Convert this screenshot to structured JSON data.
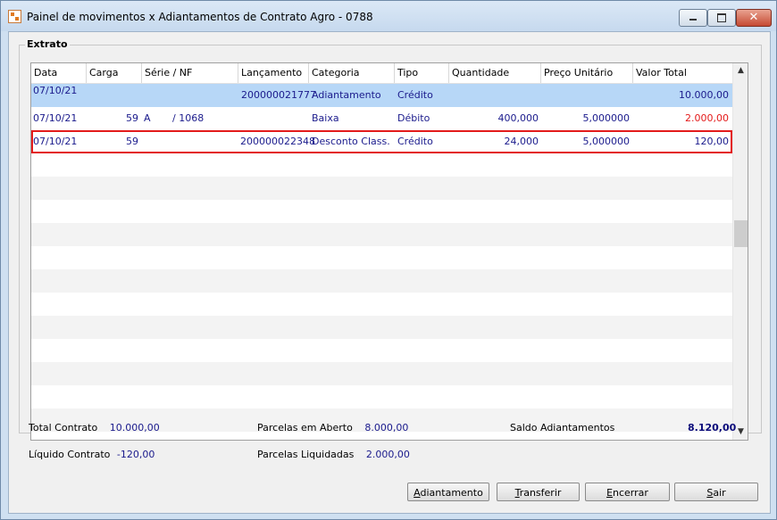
{
  "window": {
    "title": "Painel de movimentos x Adiantamentos de Contrato Agro - 0788",
    "minimize": "minimize",
    "maximize": "maximize",
    "close": "✕"
  },
  "extrato": {
    "title": "Extrato",
    "columns": [
      "Data",
      "Carga",
      "Série / NF",
      "Lançamento",
      "Categoria",
      "Tipo",
      "Quantidade",
      "Preço Unitário",
      "Valor Total"
    ],
    "rows": [
      {
        "data": "07/10/21",
        "carga": "",
        "serie": "",
        "nf": "",
        "lancamento": "200000021777",
        "categoria": "Adiantamento",
        "tipo": "Crédito",
        "quantidade": "",
        "preco": "",
        "valor": "10.000,00"
      },
      {
        "data": "07/10/21",
        "carga": "59",
        "serie": "A",
        "nf": "/ 1068",
        "lancamento": "",
        "categoria": "Baixa",
        "tipo": "Débito",
        "quantidade": "400,000",
        "preco": "5,000000",
        "valor": "2.000,00"
      },
      {
        "data": "07/10/21",
        "carga": "59",
        "serie": "",
        "nf": "",
        "lancamento": "200000022348",
        "categoria": "Desconto Class.",
        "tipo": "Crédito",
        "quantidade": "24,000",
        "preco": "5,000000",
        "valor": "120,00"
      }
    ],
    "colors": {
      "selected_row": "#b7d7f7",
      "highlight_border": "#e31b1b",
      "debit_value": "#e41a1a",
      "text": "#1a1a8c"
    }
  },
  "summary": {
    "total_contrato_label": "Total Contrato",
    "total_contrato_value": "10.000,00",
    "liquido_contrato_label": "Líquido Contrato",
    "liquido_contrato_value": "-120,00",
    "parcelas_aberto_label": "Parcelas em Aberto",
    "parcelas_aberto_value": "8.000,00",
    "parcelas_liquidadas_label": "Parcelas Liquidadas",
    "parcelas_liquidadas_value": "2.000,00",
    "saldo_label": "Saldo Adiantamentos",
    "saldo_value": "8.120,00"
  },
  "buttons": {
    "adiantamento_first": "A",
    "adiantamento_rest": "diantamento",
    "transferir_first": "T",
    "transferir_rest": "ransferir",
    "encerrar_first": "E",
    "encerrar_rest": "ncerrar",
    "sair_first": "S",
    "sair_rest": "air"
  }
}
